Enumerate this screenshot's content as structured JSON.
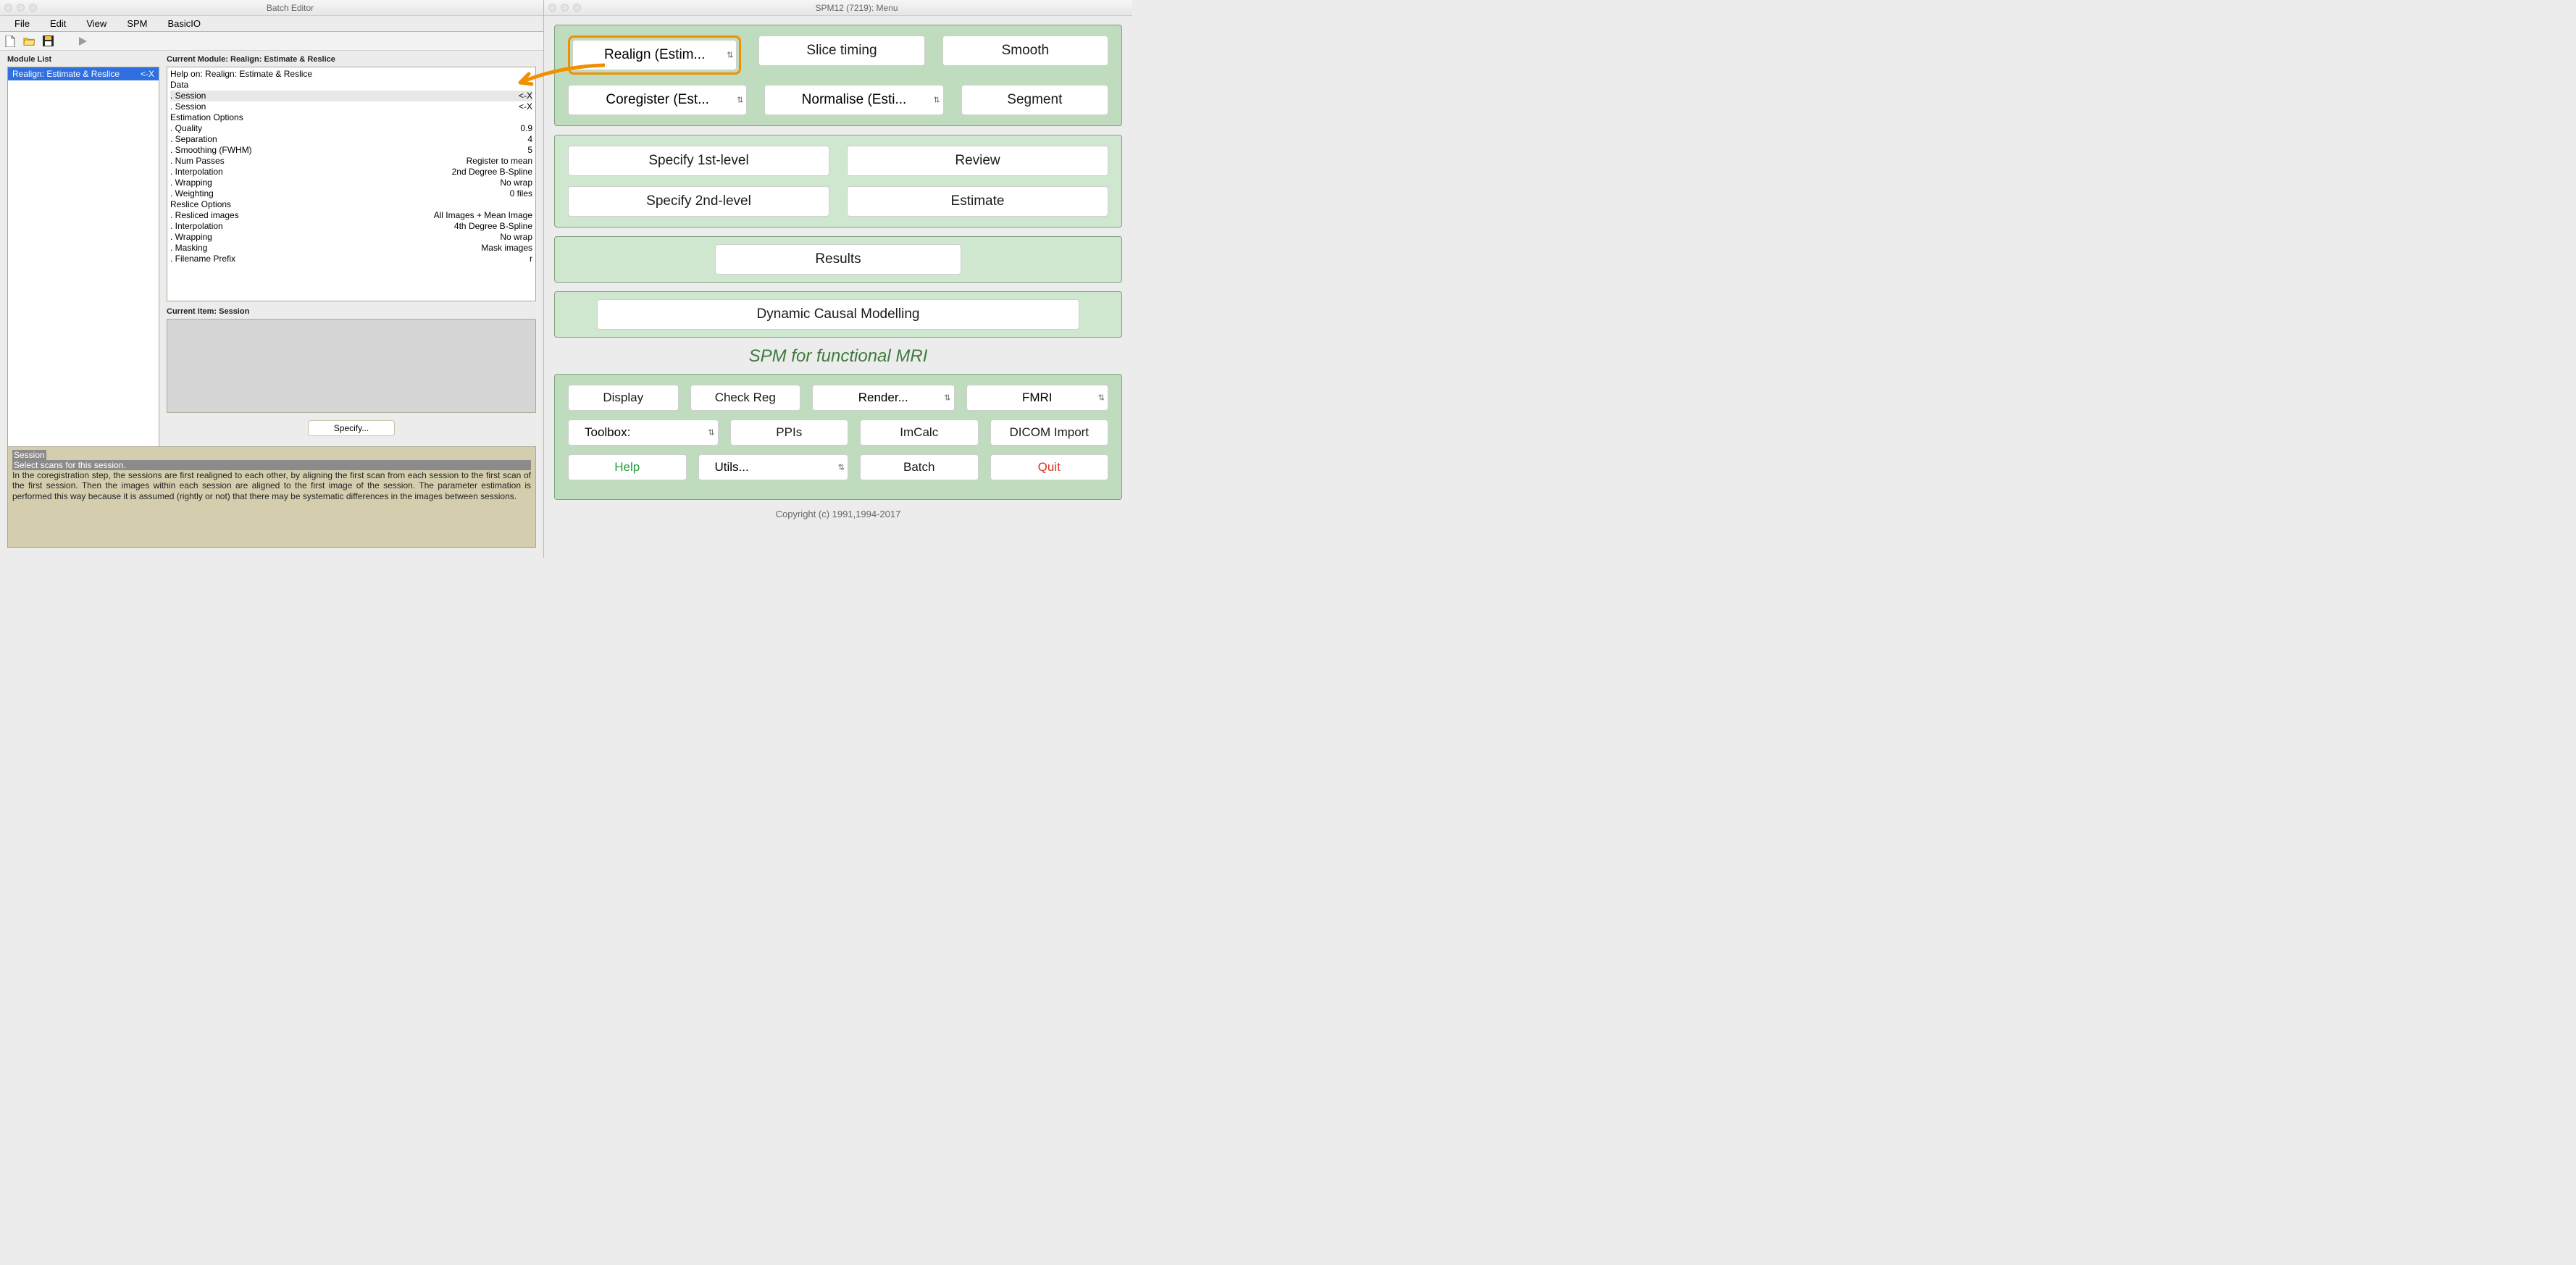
{
  "batch": {
    "title": "Batch Editor",
    "menus": [
      "File",
      "Edit",
      "View",
      "SPM",
      "BasicIO"
    ],
    "toolbar_icons": [
      "new-file-icon",
      "open-folder-icon",
      "save-icon",
      "run-icon"
    ],
    "module_list_label": "Module List",
    "module_selected": {
      "name": "Realign: Estimate & Reslice",
      "status": "<-X"
    },
    "current_module_label": "Current Module: Realign: Estimate & Reslice",
    "detail_rows": [
      {
        "l": "Help on: Realign: Estimate & Reslice",
        "r": ""
      },
      {
        "l": "Data",
        "r": ""
      },
      {
        "l": ". Session",
        "r": "<-X",
        "hi": true
      },
      {
        "l": ". Session",
        "r": "<-X"
      },
      {
        "l": "Estimation Options",
        "r": ""
      },
      {
        "l": ". Quality",
        "r": "0.9"
      },
      {
        "l": ". Separation",
        "r": "4"
      },
      {
        "l": ". Smoothing (FWHM)",
        "r": "5"
      },
      {
        "l": ". Num Passes",
        "r": "Register to mean"
      },
      {
        "l": ". Interpolation",
        "r": "2nd Degree B-Spline"
      },
      {
        "l": ". Wrapping",
        "r": "No wrap"
      },
      {
        "l": ". Weighting",
        "r": "0 files"
      },
      {
        "l": "Reslice Options",
        "r": ""
      },
      {
        "l": ". Resliced images",
        "r": "All Images + Mean Image"
      },
      {
        "l": ". Interpolation",
        "r": "4th Degree B-Spline"
      },
      {
        "l": ". Wrapping",
        "r": "No wrap"
      },
      {
        "l": ". Masking",
        "r": "Mask images"
      },
      {
        "l": ". Filename Prefix",
        "r": "r"
      }
    ],
    "current_item_label": "Current Item: Session",
    "specify_label": "Specify...",
    "help_title": "Session",
    "help_subtitle": "Select scans for this session.",
    "help_body": "In the coregistration step, the sessions are first realigned to each other, by aligning the first scan from each session to the first scan of the first session.  Then the images within each session are aligned to the first image of the session. The parameter estimation is performed this way because it is assumed (rightly or not) that there may be systematic differences in the images between sessions."
  },
  "spm": {
    "title": "SPM12 (7219): Menu",
    "spatial_row1": {
      "realign": "Realign (Estim...",
      "slice_timing": "Slice timing",
      "smooth": "Smooth"
    },
    "spatial_row2": {
      "coregister": "Coregister (Est...",
      "normalise": "Normalise (Esti...",
      "segment": "Segment"
    },
    "model": {
      "specify1": "Specify 1st-level",
      "review": "Review",
      "specify2": "Specify 2nd-level",
      "estimate": "Estimate"
    },
    "results": "Results",
    "dcm": "Dynamic Causal Modelling",
    "caption": "SPM for functional MRI",
    "util_row1": {
      "display": "Display",
      "checkreg": "Check Reg",
      "render": "Render...",
      "fmri": "FMRI"
    },
    "util_row2": {
      "toolbox": "Toolbox:",
      "ppis": "PPIs",
      "imcalc": "ImCalc",
      "dicom": "DICOM Import"
    },
    "util_row3": {
      "help": "Help",
      "utils": "Utils...",
      "batch": "Batch",
      "quit": "Quit"
    },
    "copyright": "Copyright (c) 1991,1994-2017"
  }
}
